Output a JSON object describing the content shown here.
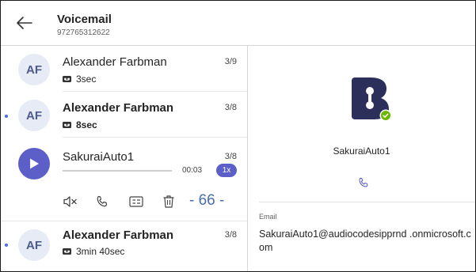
{
  "header": {
    "title": "Voicemail",
    "number": "972765312622"
  },
  "list": [
    {
      "initials": "AF",
      "name": "Alexander Farbman",
      "date": "3/9",
      "duration": "3sec",
      "unread": false
    },
    {
      "initials": "AF",
      "name": "Alexander Farbman",
      "date": "3/8",
      "duration": "8sec",
      "unread": true
    },
    {
      "name": "SakuraiAuto1",
      "date": "3/8",
      "time": "00:03",
      "speed": "1x",
      "progress": 0,
      "page_indicator": "- 66 -"
    },
    {
      "initials": "AF",
      "name": "Alexander Farbman",
      "date": "3/8",
      "duration": "3min 40sec",
      "unread": true
    }
  ],
  "detail": {
    "name": "SakuraiAuto1",
    "email_label": "Email",
    "email": "SakuraiAuto1@audiocodesipprnd .onmicrosoft.com",
    "status": "available"
  },
  "colors": {
    "accent": "#5b5fc7",
    "logo": "#2b2f59",
    "presence": "#6bb700"
  },
  "icons": [
    "back-arrow-icon",
    "voicemail-icon",
    "play-icon",
    "mute-icon",
    "phone-icon",
    "contact-card-icon",
    "trash-icon",
    "available-check-icon"
  ]
}
